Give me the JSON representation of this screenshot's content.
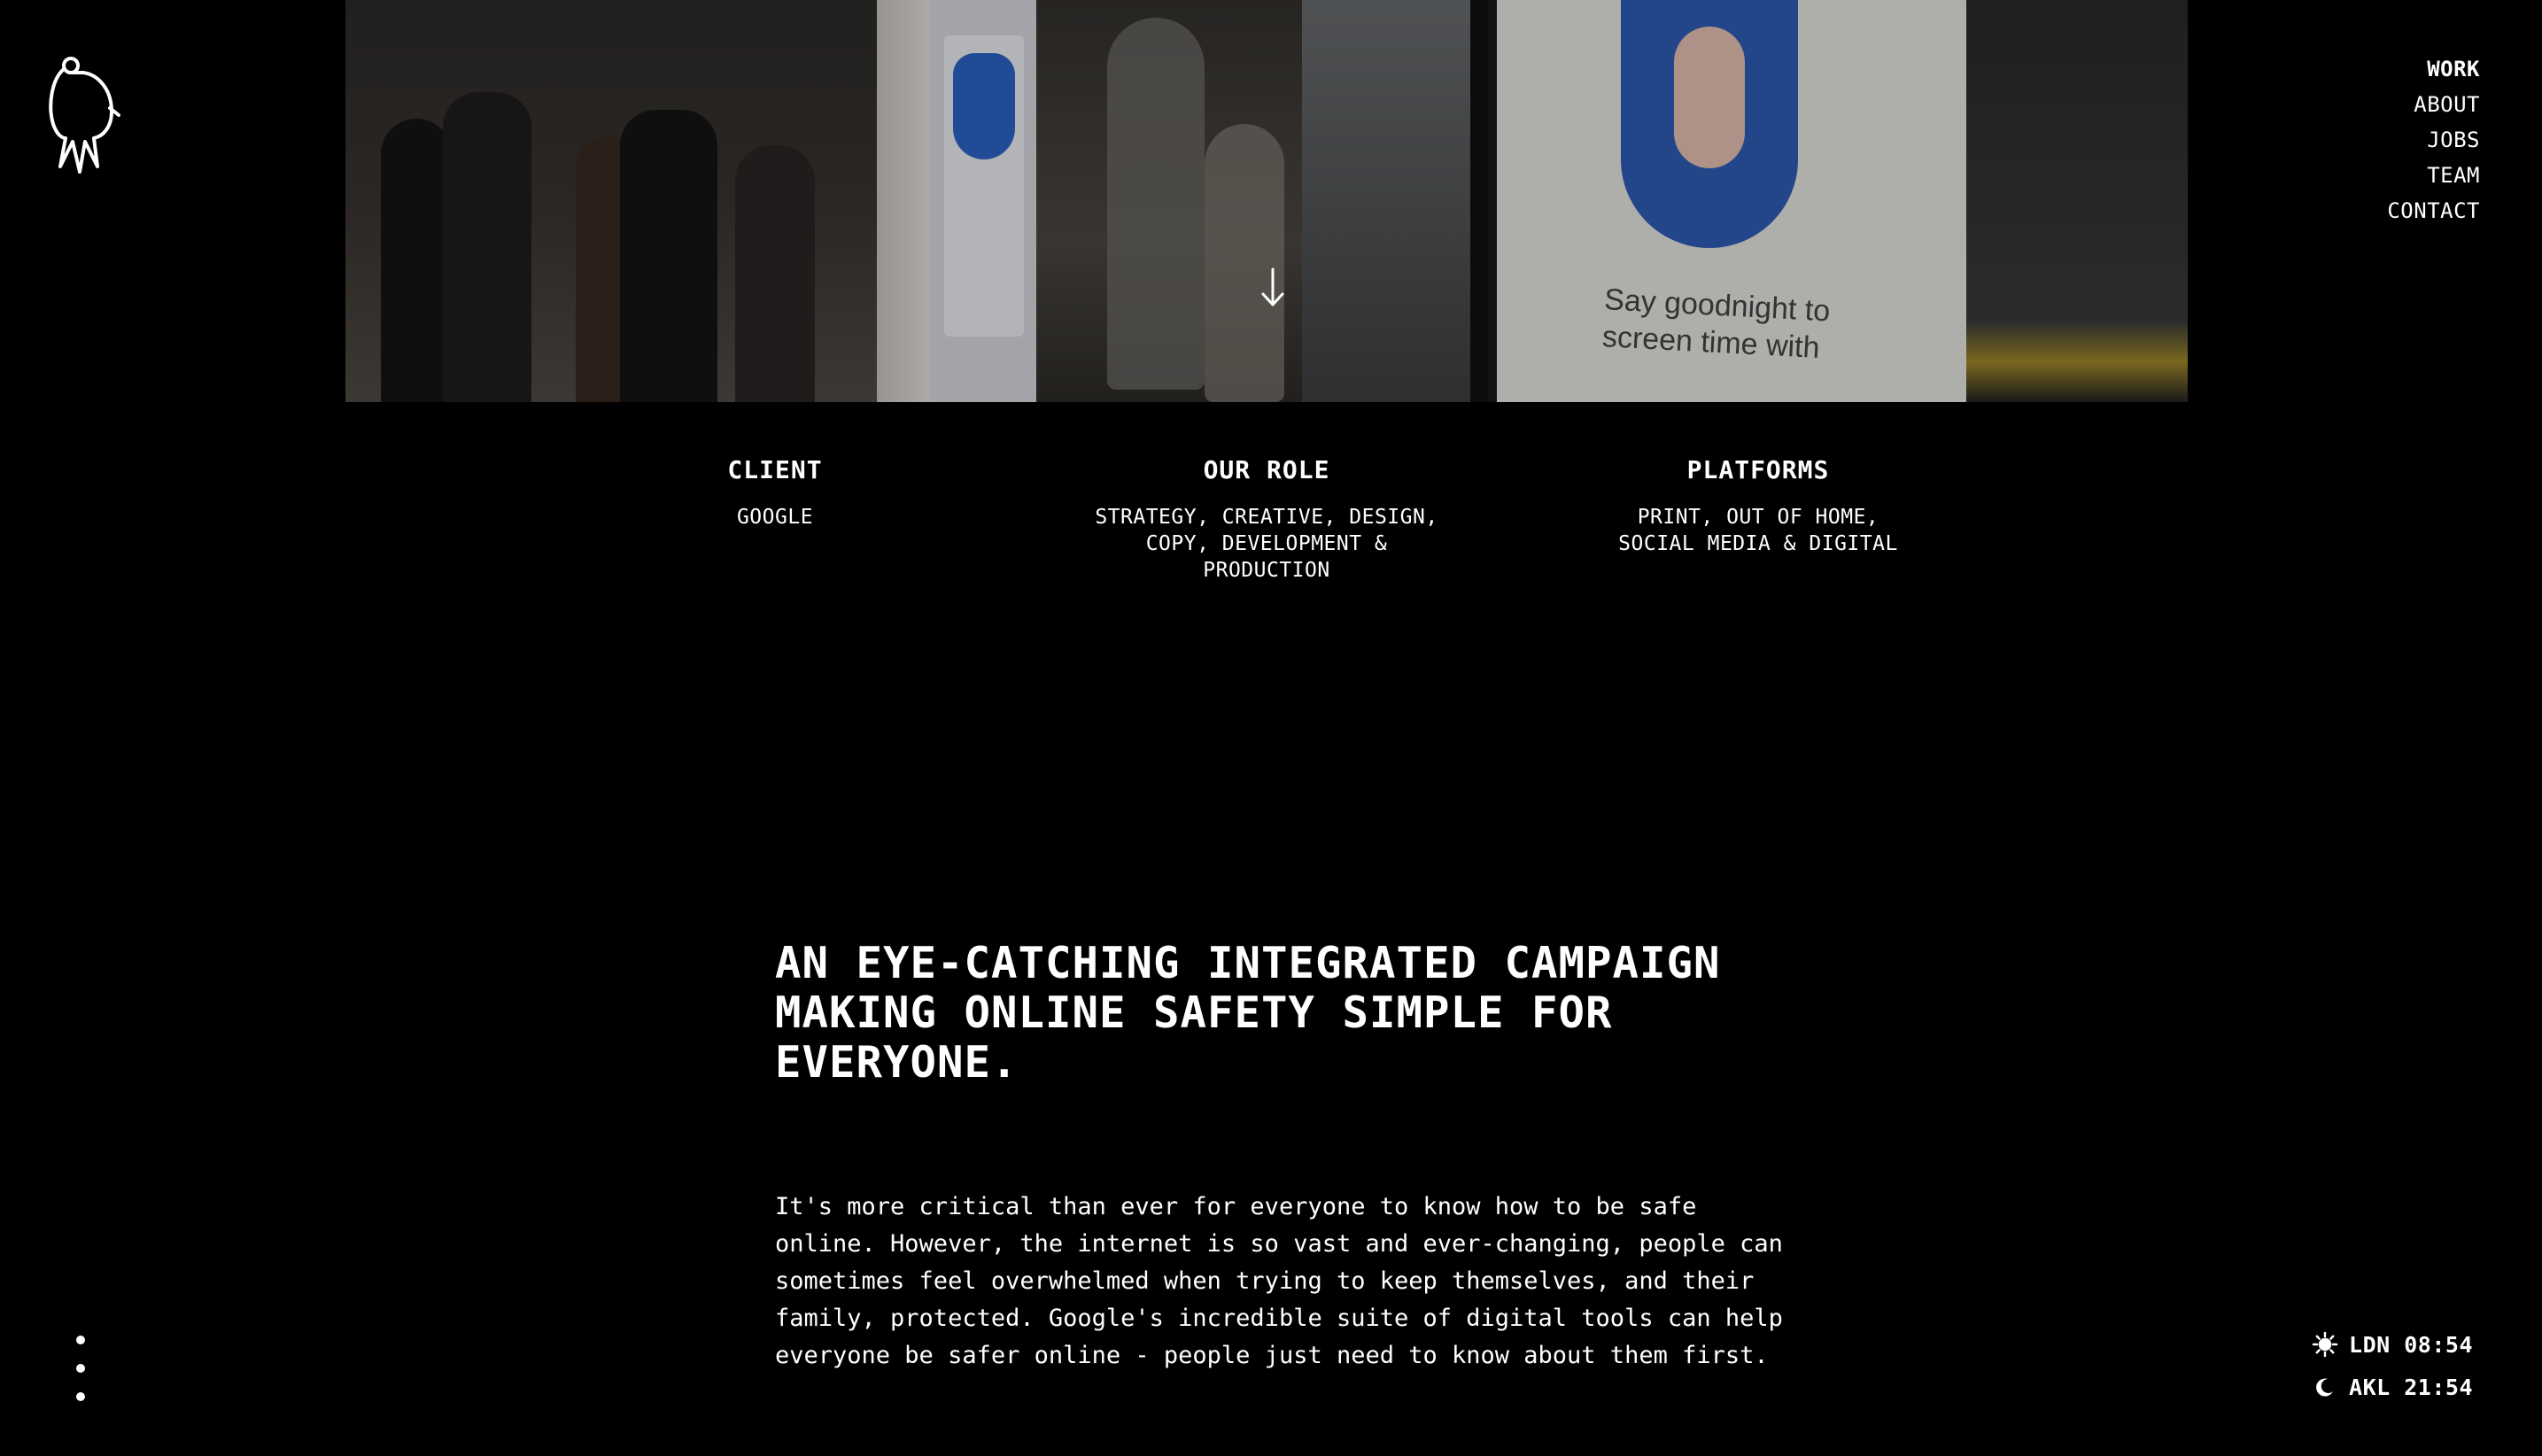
{
  "nav": {
    "items": [
      {
        "label": "WORK",
        "active": true
      },
      {
        "label": "ABOUT"
      },
      {
        "label": "JOBS"
      },
      {
        "label": "TEAM"
      },
      {
        "label": "CONTACT"
      }
    ]
  },
  "hero": {
    "ad_text": "Say goodnight to screen time with"
  },
  "project": {
    "client": {
      "heading": "CLIENT",
      "value": "GOOGLE"
    },
    "role": {
      "heading": "OUR ROLE",
      "value": "STRATEGY, CREATIVE, DESIGN, COPY, DEVELOPMENT & PRODUCTION"
    },
    "platforms": {
      "heading": "PLATFORMS",
      "value": "PRINT, OUT OF HOME, SOCIAL MEDIA & DIGITAL"
    }
  },
  "headline": "AN EYE-CATCHING INTEGRATED CAMPAIGN MAKING ONLINE SAFETY SIMPLE FOR EVERYONE.",
  "body": "It's more critical than ever for everyone to know how to be safe online. However, the internet is so vast and ever-changing, people can sometimes feel overwhelmed when trying to keep themselves, and their family, protected. Google's incredible suite of digital tools can help everyone be safer online - people just need to know about them first.",
  "clocks": {
    "ldn": {
      "icon": "sun-icon",
      "label": "LDN 08:54"
    },
    "akl": {
      "icon": "moon-icon",
      "label": "AKL 21:54"
    }
  },
  "colors": {
    "background": "#000000",
    "text": "#ffffff"
  }
}
